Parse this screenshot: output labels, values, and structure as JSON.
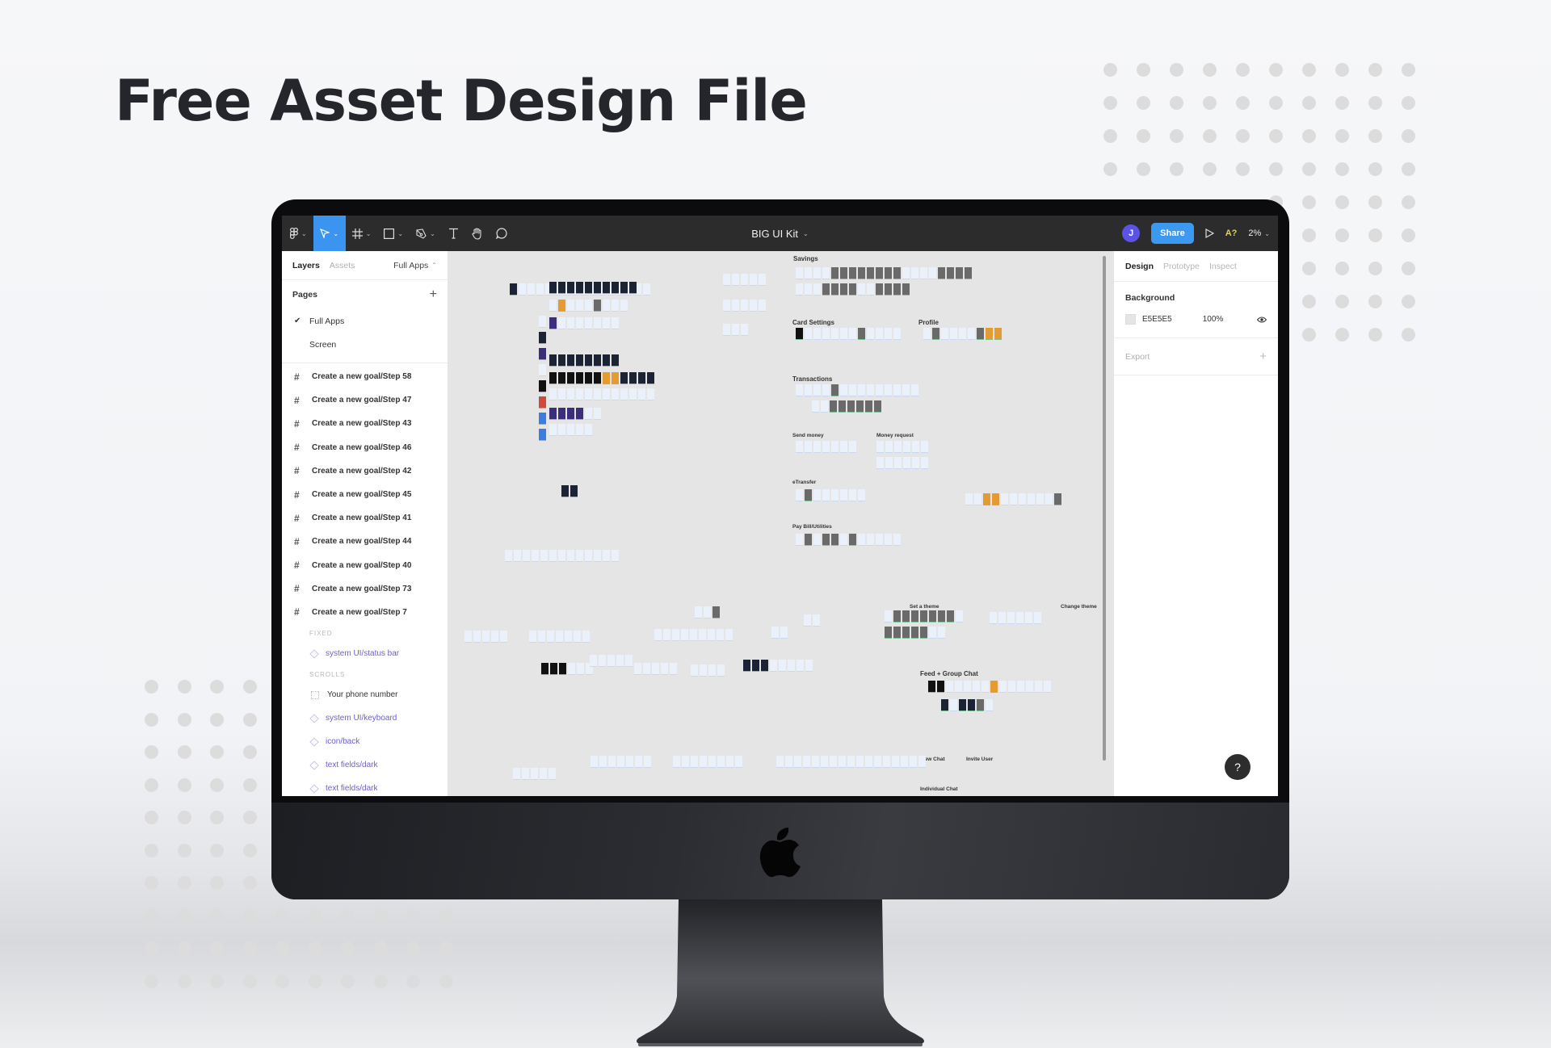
{
  "headline": "Free Asset Design File",
  "figma": {
    "toolbar": {
      "tools": [
        {
          "name": "main-menu",
          "icon": "figma-logo-icon",
          "has_caret": true,
          "active": false
        },
        {
          "name": "move-tool",
          "icon": "cursor-arrow-icon",
          "has_caret": true,
          "active": true
        },
        {
          "name": "frame-tool",
          "icon": "frame-hash-icon",
          "has_caret": true,
          "active": false
        },
        {
          "name": "shape-tool",
          "icon": "rectangle-icon",
          "has_caret": true,
          "active": false
        },
        {
          "name": "pen-tool",
          "icon": "pen-icon",
          "has_caret": true,
          "active": false
        },
        {
          "name": "text-tool",
          "icon": "text-icon",
          "has_caret": false,
          "active": false
        },
        {
          "name": "hand-tool",
          "icon": "hand-icon",
          "has_caret": false,
          "active": false
        },
        {
          "name": "comment-tool",
          "icon": "comment-icon",
          "has_caret": false,
          "active": false
        }
      ],
      "file_title": "BIG UI Kit",
      "avatar_initial": "J",
      "share_label": "Share",
      "ai_label": "A?",
      "zoom_level": "2%",
      "colors": {
        "toolbar_bg": "#2c2c2c",
        "active_tool": "#3b94f0",
        "share": "#3d98f0",
        "avatar": "#5a53e6"
      }
    },
    "left_panel": {
      "tabs": [
        {
          "label": "Layers",
          "active": true
        },
        {
          "label": "Assets",
          "active": false
        }
      ],
      "current_page": "Full Apps",
      "pages_title": "Pages",
      "pages": [
        {
          "label": "Full Apps",
          "selected": true
        },
        {
          "label": "Screen",
          "selected": false
        }
      ],
      "frames": [
        "Create a new goal/Step 58",
        "Create a new goal/Step 47",
        "Create a new goal/Step 43",
        "Create a new goal/Step 46",
        "Create a new goal/Step 42",
        "Create a new goal/Step 45",
        "Create a new goal/Step 41",
        "Create a new goal/Step 44",
        "Create a new goal/Step 40",
        "Create a new goal/Step 73",
        "Create a new goal/Step 7"
      ],
      "fixed_label": "FIXED",
      "fixed_items": [
        "system UI/status bar"
      ],
      "scrolls_label": "SCROLLS",
      "scroll_items": [
        {
          "label": "Your phone number",
          "type": "frame"
        },
        {
          "label": "system UI/keyboard",
          "type": "component"
        },
        {
          "label": "icon/back",
          "type": "component"
        },
        {
          "label": "text fields/dark",
          "type": "component"
        },
        {
          "label": "text fields/dark",
          "type": "component"
        }
      ]
    },
    "right_panel": {
      "tabs": [
        {
          "label": "Design",
          "active": true
        },
        {
          "label": "Prototype",
          "active": false
        },
        {
          "label": "Inspect",
          "active": false
        }
      ],
      "background_title": "Background",
      "background_hex": "E5E5E5",
      "background_opacity": "100%",
      "export_label": "Export",
      "help_label": "?"
    },
    "canvas": {
      "background": "#e5e5e5",
      "section_labels": [
        "Savings",
        "Card Settings",
        "Profile",
        "Transactions",
        "Send money",
        "Money request",
        "eTransfer",
        "Pay Bill/Utilities",
        "Set a theme",
        "Change theme",
        "Feed + Group Chat",
        "New Chat",
        "Invite User",
        "Individual Chat"
      ]
    }
  }
}
